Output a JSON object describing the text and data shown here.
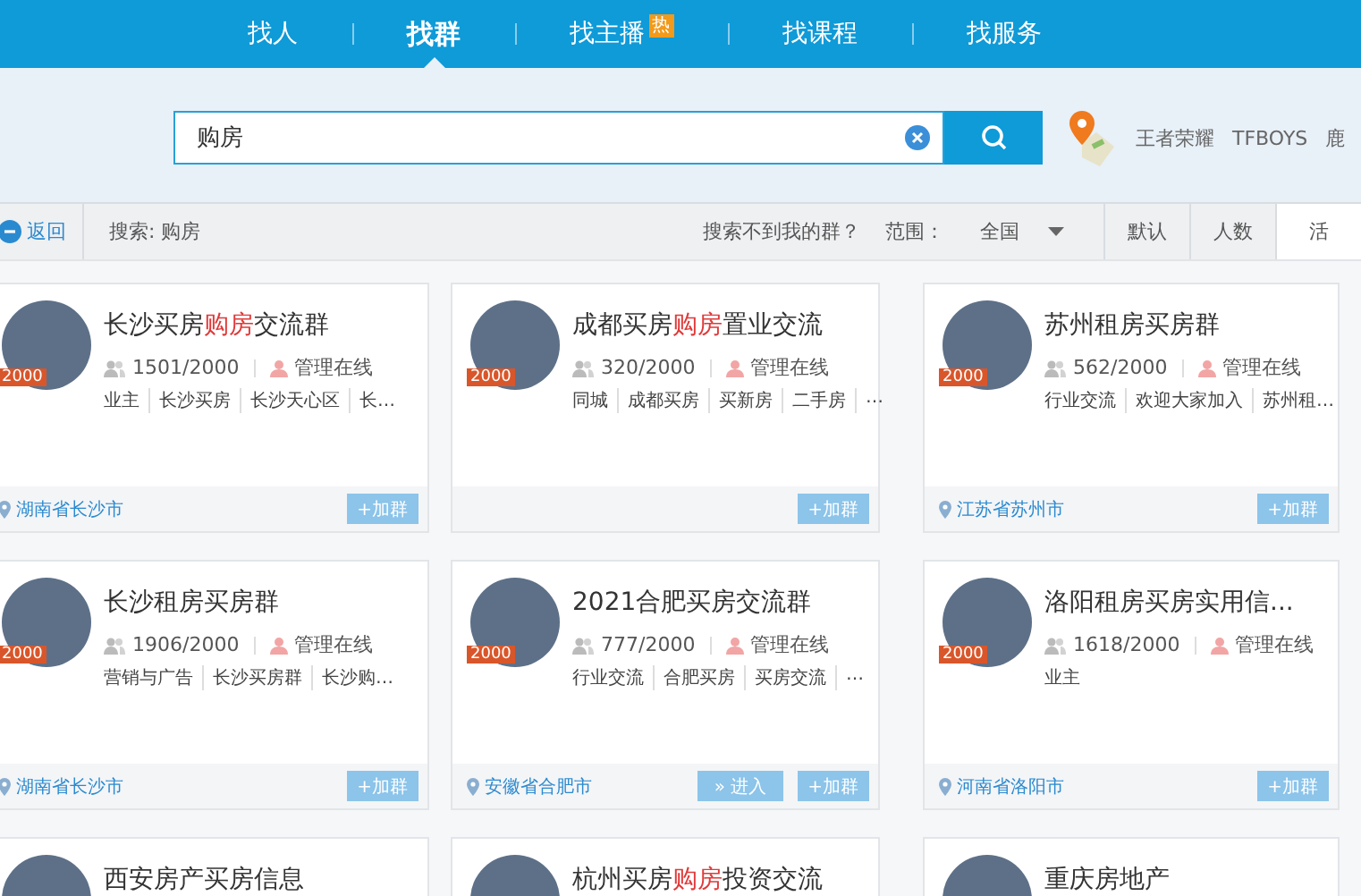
{
  "nav": [
    {
      "label": "找人",
      "selected": false
    },
    {
      "label": "找群",
      "selected": true
    },
    {
      "label": "找主播",
      "selected": false,
      "badge": "热"
    },
    {
      "label": "找课程",
      "selected": false
    },
    {
      "label": "找服务",
      "selected": false
    }
  ],
  "search": {
    "value": "购房",
    "hot_words": [
      "王者荣耀",
      "TFBOYS",
      "鹿"
    ]
  },
  "filter": {
    "back": "返回",
    "query": "搜索: 购房",
    "help": "搜索不到我的群？",
    "scope_label": "范围：",
    "scope": "全国",
    "sorts": [
      {
        "label": "默认",
        "selected": false
      },
      {
        "label": "人数",
        "selected": false
      },
      {
        "label": "活",
        "selected": true
      }
    ]
  },
  "groups": [
    {
      "title": [
        {
          "text": "长沙买房",
          "highlight": false
        },
        {
          "text": "购房",
          "highlight": true
        },
        {
          "text": "交流群",
          "highlight": false
        }
      ],
      "avatar_badge": "2000",
      "members": "1501/2000",
      "admin": "管理在线",
      "tags": [
        "业主",
        "长沙买房",
        "长沙天心区",
        "长…"
      ],
      "location": "湖南省长沙市",
      "buttons": [
        {
          "kind": "join",
          "label": "+加群"
        }
      ]
    },
    {
      "title": [
        {
          "text": "成都买房",
          "highlight": false
        },
        {
          "text": "购房",
          "highlight": true
        },
        {
          "text": "置业交流",
          "highlight": false
        }
      ],
      "avatar_badge": "2000",
      "members": "320/2000",
      "admin": "管理在线",
      "tags": [
        "同城",
        "成都买房",
        "买新房",
        "二手房",
        "…"
      ],
      "buttons": [
        {
          "kind": "join",
          "label": "+加群"
        }
      ]
    },
    {
      "title": [
        {
          "text": "苏州租房买房群",
          "highlight": false
        }
      ],
      "avatar_badge": "2000",
      "members": "562/2000",
      "admin": "管理在线",
      "tags": [
        "行业交流",
        "欢迎大家加入",
        "苏州租…"
      ],
      "location": "江苏省苏州市",
      "buttons": [
        {
          "kind": "join",
          "label": "+加群"
        }
      ]
    },
    {
      "title": [
        {
          "text": "长沙租房买房群",
          "highlight": false
        }
      ],
      "avatar_badge": "2000",
      "members": "1906/2000",
      "admin": "管理在线",
      "tags": [
        "营销与广告",
        "长沙买房群",
        "长沙购…"
      ],
      "location": "湖南省长沙市",
      "buttons": [
        {
          "kind": "join",
          "label": "+加群"
        }
      ]
    },
    {
      "title": [
        {
          "text": "2021合肥买房交流群",
          "highlight": false
        }
      ],
      "avatar_badge": "2000",
      "members": "777/2000",
      "admin": "管理在线",
      "tags": [
        "行业交流",
        "合肥买房",
        "买房交流",
        "…"
      ],
      "location": "安徽省合肥市",
      "buttons": [
        {
          "kind": "enter",
          "label": "» 进入"
        },
        {
          "kind": "join",
          "label": "+加群"
        }
      ]
    },
    {
      "title": [
        {
          "text": "洛阳租房买房实用信...",
          "highlight": false
        }
      ],
      "avatar_badge": "2000",
      "members": "1618/2000",
      "admin": "管理在线",
      "tags": [
        "业主"
      ],
      "location": "河南省洛阳市",
      "buttons": [
        {
          "kind": "join",
          "label": "+加群"
        }
      ]
    },
    {
      "title": [
        {
          "text": "西安房产买房信息",
          "highlight": false
        }
      ]
    },
    {
      "title": [
        {
          "text": "杭州买房",
          "highlight": false
        },
        {
          "text": "购房",
          "highlight": true
        },
        {
          "text": "投资交流",
          "highlight": false
        }
      ]
    },
    {
      "title": [
        {
          "text": "重庆房地产",
          "highlight": false
        }
      ]
    }
  ]
}
